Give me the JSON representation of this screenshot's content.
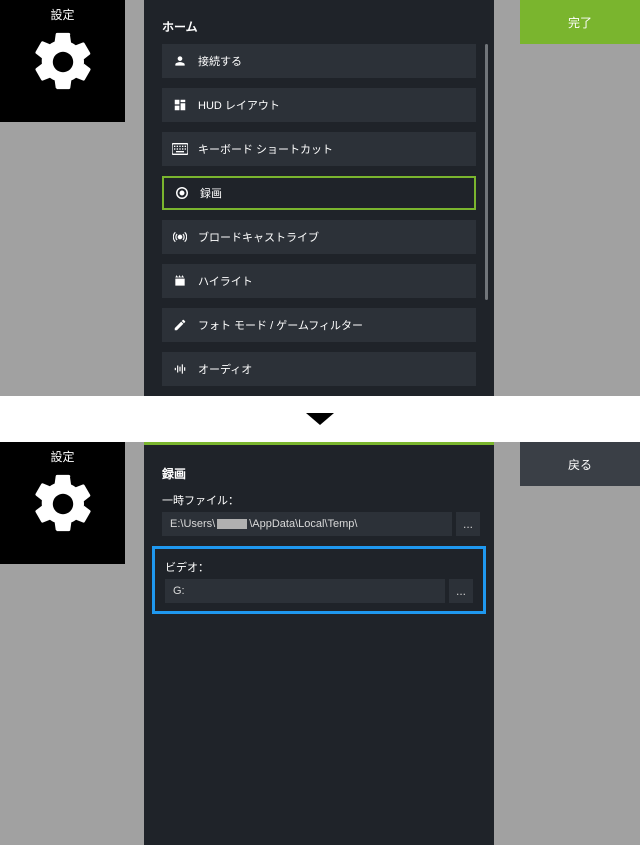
{
  "top": {
    "settings_label": "設定",
    "panel_title": "ホーム",
    "menu": [
      {
        "label": "接続する",
        "icon": "person",
        "selected": false
      },
      {
        "label": "HUD レイアウト",
        "icon": "layout",
        "selected": false
      },
      {
        "label": "キーボード ショートカット",
        "icon": "keyboard",
        "selected": false
      },
      {
        "label": "録画",
        "icon": "record",
        "selected": true
      },
      {
        "label": "ブロードキャストライブ",
        "icon": "broadcast",
        "selected": false
      },
      {
        "label": "ハイライト",
        "icon": "clapper",
        "selected": false
      },
      {
        "label": "フォト モード / ゲームフィルター",
        "icon": "edit",
        "selected": false
      },
      {
        "label": "オーディオ",
        "icon": "audio",
        "selected": false
      }
    ],
    "done_button": "完了"
  },
  "bottom": {
    "settings_label": "設定",
    "heading": "録画",
    "temp_label": "一時ファイル：",
    "temp_path_prefix": "E:\\Users\\",
    "temp_path_suffix": "\\AppData\\Local\\Temp\\",
    "video_label": "ビデオ：",
    "video_path": "G:",
    "browse_label": "...",
    "back_button": "戻る"
  }
}
